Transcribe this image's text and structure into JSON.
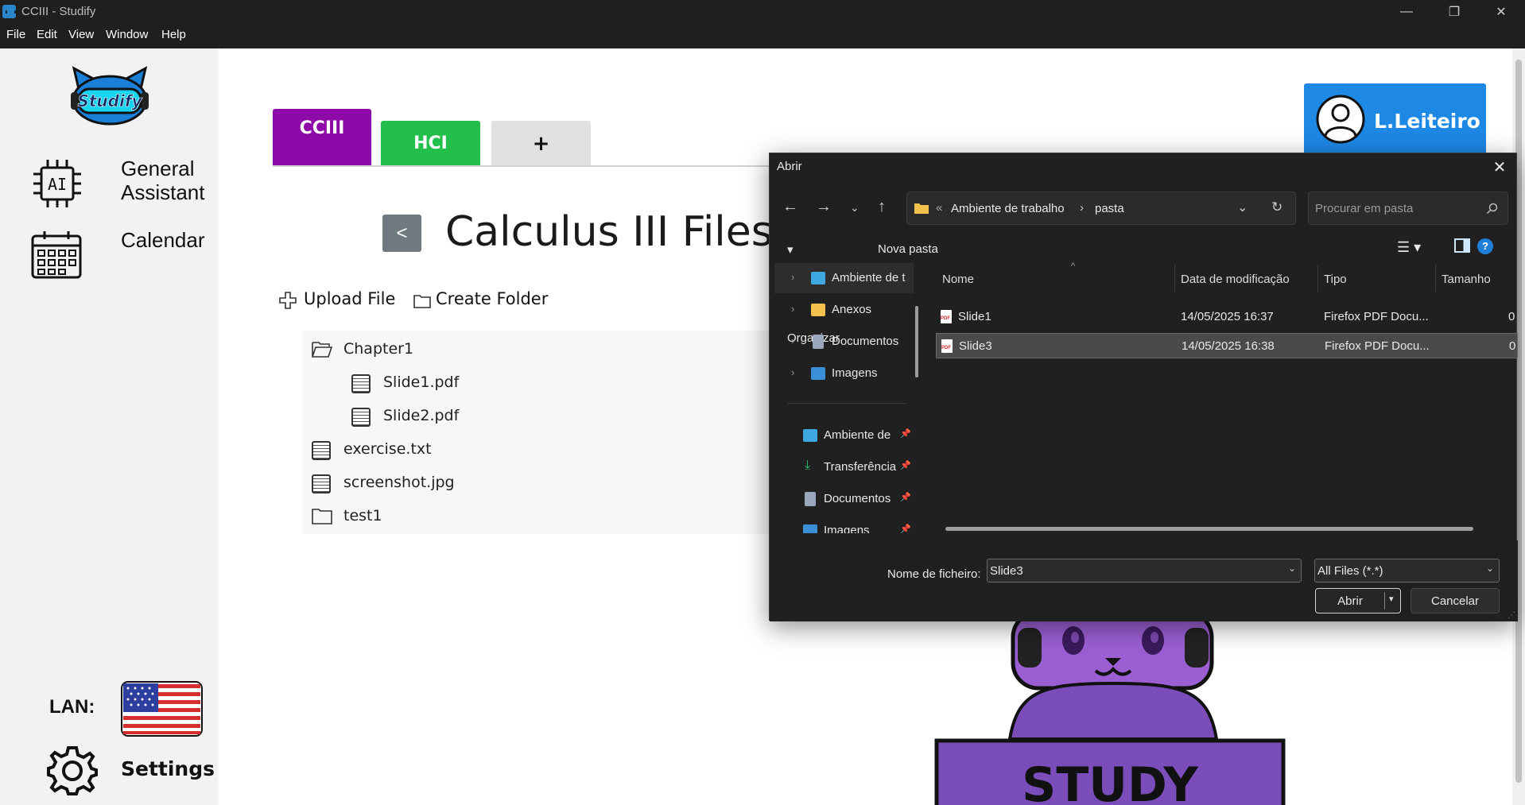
{
  "window": {
    "title": "CCIII - Studify",
    "controls": {
      "minimize": "—",
      "maximize": "❐",
      "close": "✕"
    }
  },
  "menu": [
    "File",
    "Edit",
    "View",
    "Window",
    "Help"
  ],
  "sidebar": {
    "logo_text": "Studify",
    "items": [
      {
        "label_line1": "General",
        "label_line2": "Assistant",
        "icon": "ai-chip-icon"
      },
      {
        "label": "Calendar",
        "icon": "calendar-icon"
      }
    ],
    "language_label": "LAN:",
    "language_flag": "us-flag-icon",
    "settings_label": "Settings"
  },
  "tabs": [
    {
      "label": "CCIII",
      "color": "#8e0aa8",
      "active": true
    },
    {
      "label": "HCI",
      "color": "#22c04b",
      "active": false
    },
    {
      "label": "+",
      "color": "#e0e0e0",
      "active": false
    }
  ],
  "main": {
    "back_label": "<",
    "page_title": "Calculus III Files",
    "upload_label": "Upload File",
    "create_folder_label": "Create Folder",
    "tree": [
      {
        "name": "Chapter1",
        "type": "folder-open",
        "indent": 0
      },
      {
        "name": "Slide1.pdf",
        "type": "file",
        "indent": 1
      },
      {
        "name": "Slide2.pdf",
        "type": "file",
        "indent": 1
      },
      {
        "name": "exercise.txt",
        "type": "file",
        "indent": 0
      },
      {
        "name": "screenshot.jpg",
        "type": "file",
        "indent": 0
      },
      {
        "name": "test1",
        "type": "folder",
        "indent": 0
      }
    ]
  },
  "profile": {
    "name": "L.Leiteiro"
  },
  "mascot": {
    "sign_text": "STUDY"
  },
  "dialog": {
    "title": "Abrir",
    "breadcrumb": [
      "Ambiente de trabalho",
      "pasta"
    ],
    "breadcrumb_overflow": "«",
    "search_placeholder": "Procurar em pasta",
    "organize_label": "Organizar",
    "new_folder_label": "Nova pasta",
    "nav_items": [
      {
        "label": "Ambiente de t",
        "icon": "desktop-icon",
        "expandable": true,
        "selected": true
      },
      {
        "label": "Anexos",
        "icon": "folder-icon",
        "expandable": true
      },
      {
        "label": "Documentos",
        "icon": "documents-icon",
        "expandable": true
      },
      {
        "label": "Imagens",
        "icon": "pictures-icon",
        "expandable": true
      }
    ],
    "quick_access": [
      {
        "label": "Ambiente de",
        "icon": "desktop-icon"
      },
      {
        "label": "Transferência",
        "icon": "download-icon"
      },
      {
        "label": "Documentos",
        "icon": "documents-icon"
      },
      {
        "label": "Imagens",
        "icon": "pictures-icon"
      }
    ],
    "columns": [
      "Nome",
      "Data de modificação",
      "Tipo",
      "Tamanho"
    ],
    "files": [
      {
        "name": "Slide1",
        "modified": "14/05/2025 16:37",
        "type": "Firefox PDF Docu...",
        "size": "0",
        "selected": false
      },
      {
        "name": "Slide3",
        "modified": "14/05/2025 16:38",
        "type": "Firefox PDF Docu...",
        "size": "0",
        "selected": true
      }
    ],
    "filename_label": "Nome de ficheiro:",
    "filename_value": "Slide3",
    "filetype_value": "All Files (*.*)",
    "open_label": "Abrir",
    "cancel_label": "Cancelar"
  }
}
